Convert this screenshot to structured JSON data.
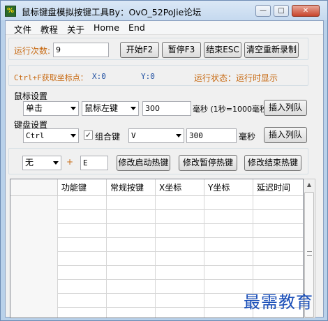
{
  "title": "鼠标键盘模拟按键工具By：OvO_52PoJie论坛",
  "menu": [
    "文件",
    "教程",
    "关于",
    "Home",
    "End"
  ],
  "window_buttons": {
    "minimize": "—",
    "maximize": "□",
    "close": "✕"
  },
  "run_count": {
    "label": "运行次数:",
    "value": "9"
  },
  "buttons": {
    "start": "开始F2",
    "pause": "暂停F3",
    "end": "结束ESC",
    "clear": "清空重新录制"
  },
  "coords": {
    "hint": "Ctrl+F获取坐标点：",
    "x_label": "X:0",
    "y_label": "Y:0",
    "status": "运行状态：运行时显示"
  },
  "mouse": {
    "section": "鼠标设置",
    "action": "单击",
    "button": "鼠标左键",
    "delay": "300",
    "unit": "毫秒 (1秒=1000毫秒)",
    "insert": "插入列队"
  },
  "keyboard": {
    "section": "键盘设置",
    "modifier": "Ctrl",
    "combo_label": "组合键",
    "combo_checked": "✓",
    "key": "V",
    "delay": "300",
    "unit": "毫秒",
    "insert": "插入列队"
  },
  "hotkey": {
    "modifier": "无",
    "plus": "+",
    "key": "E",
    "start": "修改启动热键",
    "pause": "修改暂停热键",
    "end": "修改结束热键"
  },
  "table": {
    "headers": [
      "",
      "功能键",
      "常规按键",
      "X坐标",
      "Y坐标",
      "延迟时间"
    ]
  },
  "watermark": "最需教育"
}
